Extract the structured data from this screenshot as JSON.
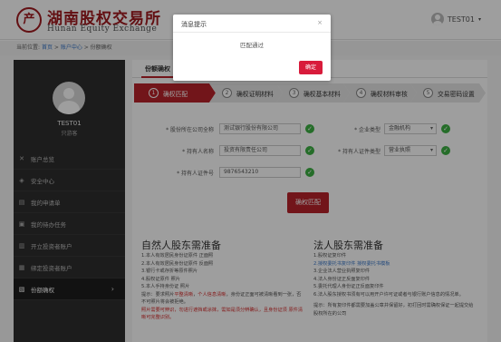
{
  "header": {
    "logo_seal": "产",
    "logo_cn": "湖南股权交易所",
    "logo_en": "Hunan Equity Exchange",
    "username": "TEST01"
  },
  "breadcrumb": {
    "prefix": "当前位置:",
    "items": [
      "首页",
      "账户中心",
      "份额确权"
    ]
  },
  "sidebar": {
    "username": "TEST01",
    "role": "只游客",
    "items": [
      {
        "label": "账户总览",
        "icon": "x-icon"
      },
      {
        "label": "安全中心",
        "icon": "shield-icon"
      },
      {
        "label": "我的申请单",
        "icon": "document-icon"
      },
      {
        "label": "我的待办任务",
        "icon": "tasks-icon"
      },
      {
        "label": "开立投资者账户",
        "icon": "account-icon"
      },
      {
        "label": "绑定投资者账户",
        "icon": "link-icon"
      },
      {
        "label": "份额确权",
        "icon": "check-icon",
        "active": true
      }
    ]
  },
  "main": {
    "title": "份额确权",
    "steps": [
      {
        "num": "1",
        "label": "确权匹配"
      },
      {
        "num": "2",
        "label": "确权证明材料"
      },
      {
        "num": "3",
        "label": "确权基本材料"
      },
      {
        "num": "4",
        "label": "确权材料审核"
      },
      {
        "num": "5",
        "label": "交易密码设置"
      }
    ],
    "form": {
      "company_label": "* 股份所在公司全称",
      "company_value": "测试银行股份有限公司",
      "ent_type_label": "* 企业类型",
      "ent_type_value": "金融机构",
      "holder_label": "* 持有人名称",
      "holder_value": "投资有限责任公司",
      "cert_type_label": "* 持有人证件类型",
      "cert_type_value": "营业执照",
      "cert_no_label": "* 持有人证件号",
      "cert_no_value": "9876543210"
    },
    "submit_label": "确权匹配",
    "natural": {
      "heading": "自然人股东需准备",
      "lines": [
        "1.本人有效居民身份证原件 正面照",
        "2.本人有效居民身份证原件 反面照",
        "3.银行卡或存折等原件照片",
        "4.股权证原件 照片",
        "5.本人手持身份证 照片"
      ],
      "tip_prefix": "提示：要求照片",
      "tip_red1": "平整清晰",
      "tip_mid": "，",
      "tip_red2": "个人信息清晰",
      "tip_rest": "，身份证正面可被清晰看到一张，否不可照片将会被拒绝。",
      "tip_line2": "照片需要可辨识，勿进行遮挡或涂抹，需如是须分辨确认，且身份证须 原件清晰可完整识别。"
    },
    "legal": {
      "heading": "法人股东需准备",
      "lines": [
        "1.股权证复印件",
        "2.授权委托书复印件 授权委托书模板",
        "3.企业法人营业执照复印件",
        "4.法人身份证正反面复印件",
        "5.委托代理人身份证正反面复印件",
        "6.法人股东授权书须有可以用开户许可证或者与银行账户信息的情况单。"
      ],
      "tip": "提示：所有复印件都需要加盖公章并保留好，初打回时需确权保证一起提交给股权所在的公司"
    }
  },
  "modal": {
    "title": "消息提示",
    "close": "×",
    "message": "匹配通过",
    "ok_label": "确定"
  }
}
